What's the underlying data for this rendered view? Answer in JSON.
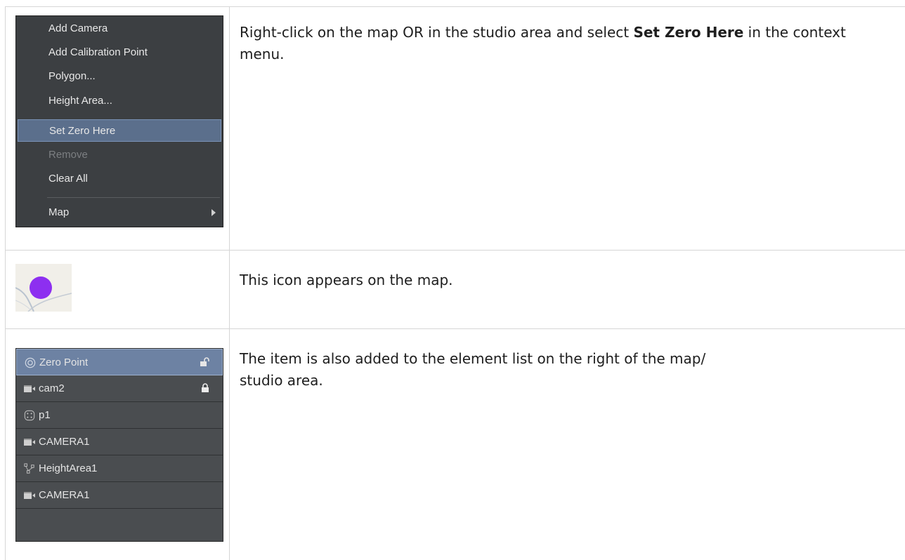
{
  "context_menu": {
    "items": [
      {
        "label": "Add Camera",
        "state": "normal"
      },
      {
        "label": "Add Calibration Point",
        "state": "normal"
      },
      {
        "label": "Polygon...",
        "state": "normal"
      },
      {
        "label": "Height Area...",
        "state": "normal"
      },
      {
        "label": "Set Zero Here",
        "state": "selected"
      },
      {
        "label": "Remove",
        "state": "disabled"
      },
      {
        "label": "Clear All",
        "state": "normal"
      },
      {
        "label": "Map",
        "state": "submenu"
      }
    ]
  },
  "row1": {
    "text_before": "Right-click on the map OR in the studio area and select ",
    "text_bold": "Set Zero Here",
    "text_after": " in the context menu."
  },
  "row2": {
    "text": "This icon appears on the map.",
    "icon": "zero-point-dot-icon",
    "dot_color": "#8d2ff0"
  },
  "row3": {
    "text_line1": "The item is also added to the element list on the right of the map/",
    "text_line2": "studio area."
  },
  "element_list": {
    "items": [
      {
        "label": "Zero Point",
        "icon": "zero-point-icon",
        "lock": "unlocked",
        "selected": true
      },
      {
        "label": "cam2",
        "icon": "camera-icon",
        "lock": "locked",
        "selected": false
      },
      {
        "label": "p1",
        "icon": "calibration-point-icon",
        "lock": "",
        "selected": false
      },
      {
        "label": "CAMERA1",
        "icon": "camera-icon",
        "lock": "",
        "selected": false
      },
      {
        "label": "HeightArea1",
        "icon": "height-area-icon",
        "lock": "",
        "selected": false
      },
      {
        "label": "CAMERA1",
        "icon": "camera-icon",
        "lock": "",
        "selected": false
      }
    ]
  }
}
